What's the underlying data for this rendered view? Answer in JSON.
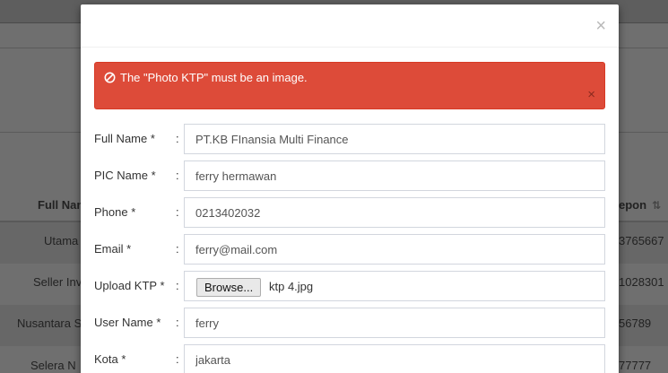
{
  "background": {
    "table": {
      "headers": {
        "full_name": "Full Nam",
        "telepon": "epon"
      },
      "rows": [
        {
          "name": "Utama",
          "phone": "3765667"
        },
        {
          "name": "Seller Inv",
          "phone": "1028301"
        },
        {
          "name": "Nusantara S",
          "phone": "56789"
        },
        {
          "name": "Selera N",
          "phone": "77777"
        }
      ]
    }
  },
  "modal": {
    "close_symbol": "×",
    "alert": {
      "message": "The \"Photo KTP\" must be an image.",
      "close_symbol": "×",
      "color": "#dd4b39"
    },
    "separator": ":",
    "fields": {
      "full_name": {
        "label": "Full Name *",
        "value": "PT.KB FInansia Multi Finance"
      },
      "pic_name": {
        "label": "PIC Name *",
        "value": "ferry hermawan"
      },
      "phone": {
        "label": "Phone *",
        "value": "0213402032"
      },
      "email": {
        "label": "Email *",
        "value": "ferry@mail.com"
      },
      "upload_ktp": {
        "label": "Upload KTP *",
        "button_label": "Browse...",
        "file_name": "ktp 4.jpg"
      },
      "user_name": {
        "label": "User Name *",
        "value": "ferry"
      },
      "kota": {
        "label": "Kota *",
        "value": "jakarta"
      }
    }
  }
}
